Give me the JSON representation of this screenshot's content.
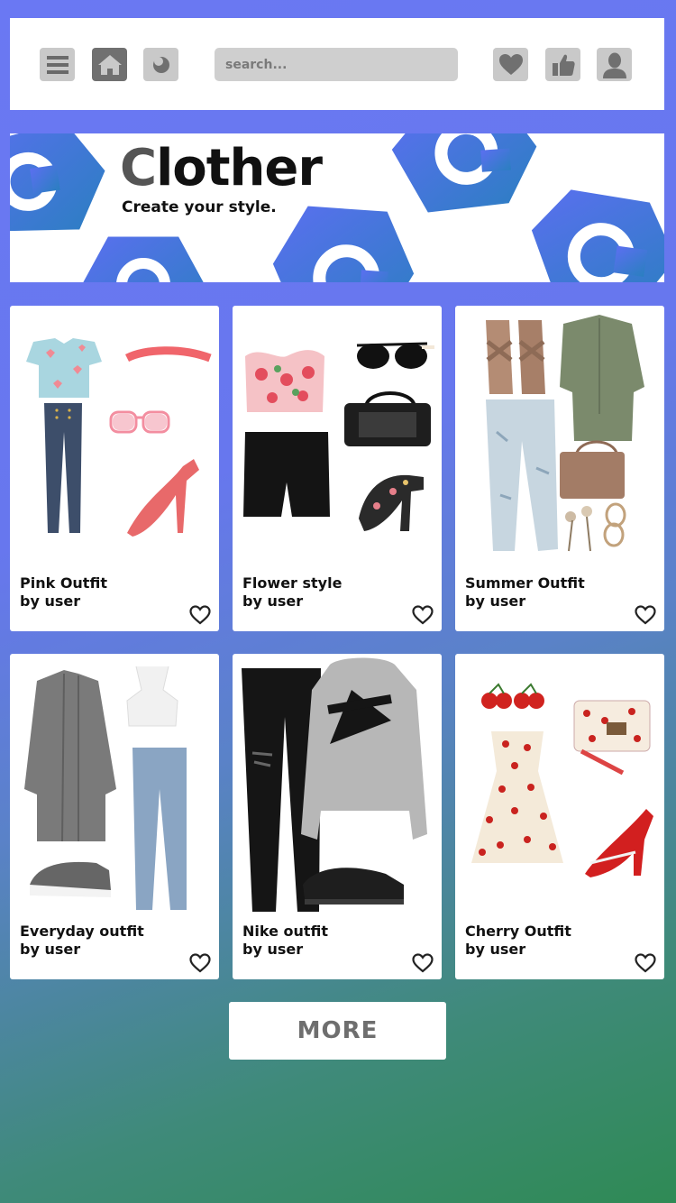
{
  "header": {
    "search_placeholder": "search..."
  },
  "banner": {
    "brand_first": "C",
    "brand_rest": "lother",
    "tagline": "Create your style."
  },
  "outfits": [
    {
      "title": "Pink Outfit",
      "byline": "by user"
    },
    {
      "title": "Flower style",
      "byline": "by user"
    },
    {
      "title": "Summer Outfit",
      "byline": "by user"
    },
    {
      "title": "Everyday outfit",
      "byline": "by user"
    },
    {
      "title": "Nike outfit",
      "byline": "by user"
    },
    {
      "title": "Cherry Outfit",
      "byline": "by user"
    }
  ],
  "more_label": "MORE",
  "colors": {
    "accent_blue": "#5b6ff0",
    "icon_gray": "#707070",
    "button_gray": "#c9c9c9"
  }
}
